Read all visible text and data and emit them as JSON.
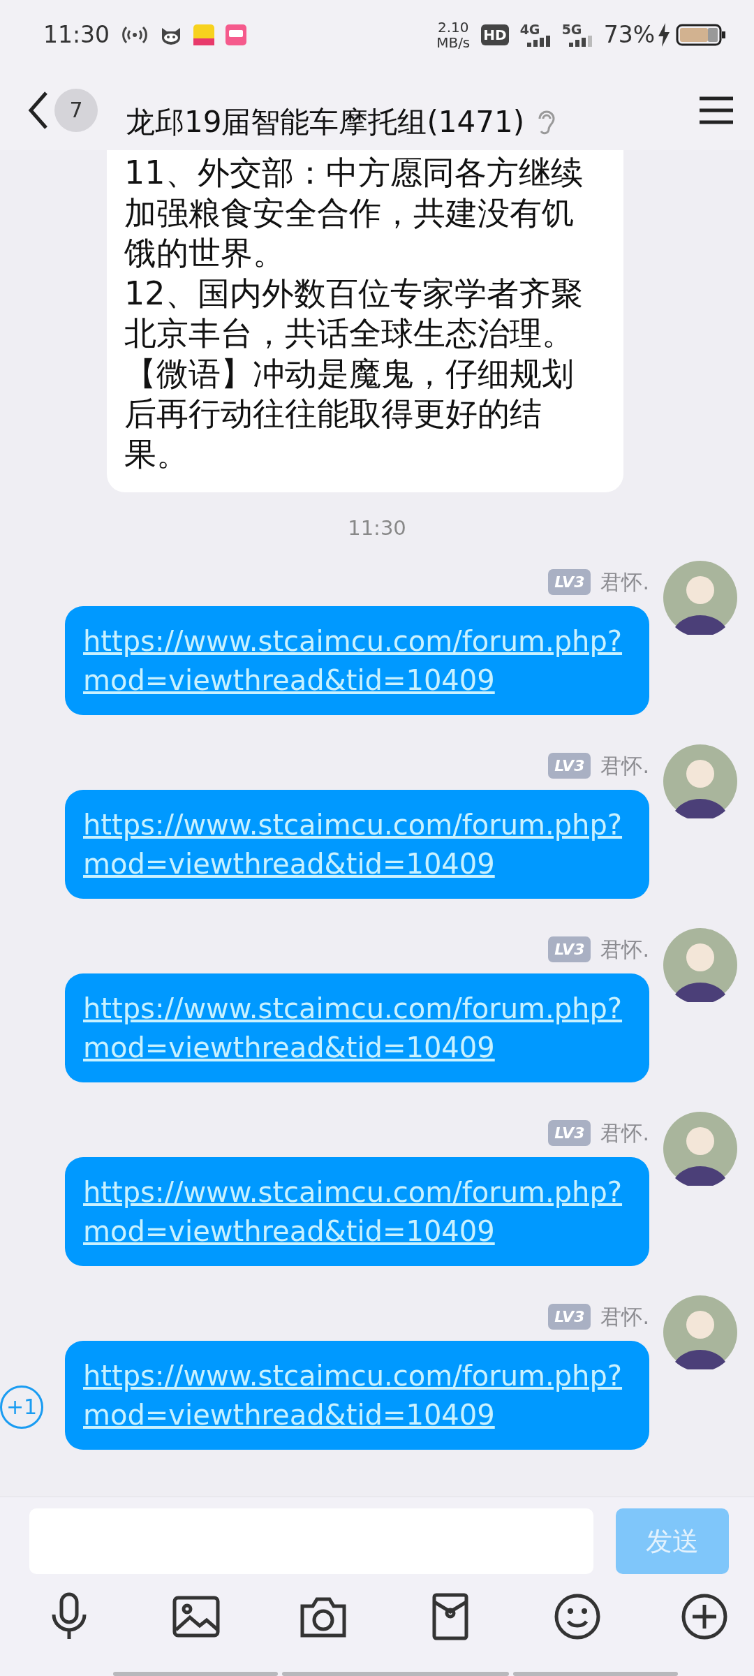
{
  "status_bar": {
    "time": "11:30",
    "speed_value": "2.10",
    "speed_unit": "MB/s",
    "network_labels": [
      "HD",
      "4G",
      "5G"
    ],
    "battery": "73%",
    "charging": true
  },
  "header": {
    "unread_count": "7",
    "title": "龙邱19届智能车摩托组(1471)"
  },
  "messages": [
    {
      "kind": "news",
      "paragraphs": [
        "11、外交部：中方愿同各方继续加强粮食安全合作，共建没有饥饿的世界。",
        "12、国内外数百位专家学者齐聚北京丰台，共话全球生态治理。",
        "【微语】冲动是魔鬼，仔细规划后再行动往往能取得更好的结果。"
      ]
    },
    {
      "kind": "time",
      "text": "11:30"
    },
    {
      "kind": "link",
      "level_badge": "LV3",
      "sender": "君怀.",
      "link": "https://www.stcaimcu.com/forum.php?mod=viewthread&tid=10409"
    },
    {
      "kind": "link",
      "level_badge": "LV3",
      "sender": "君怀.",
      "link": "https://www.stcaimcu.com/forum.php?mod=viewthread&tid=10409"
    },
    {
      "kind": "link",
      "level_badge": "LV3",
      "sender": "君怀.",
      "link": "https://www.stcaimcu.com/forum.php?mod=viewthread&tid=10409"
    },
    {
      "kind": "link",
      "level_badge": "LV3",
      "sender": "君怀.",
      "link": "https://www.stcaimcu.com/forum.php?mod=viewthread&tid=10409"
    },
    {
      "kind": "link",
      "level_badge": "LV3",
      "sender": "君怀.",
      "link": "https://www.stcaimcu.com/forum.php?mod=viewthread&tid=10409",
      "plus_one": "+1"
    }
  ],
  "composer": {
    "send_label": "发送",
    "send_disabled": true
  }
}
